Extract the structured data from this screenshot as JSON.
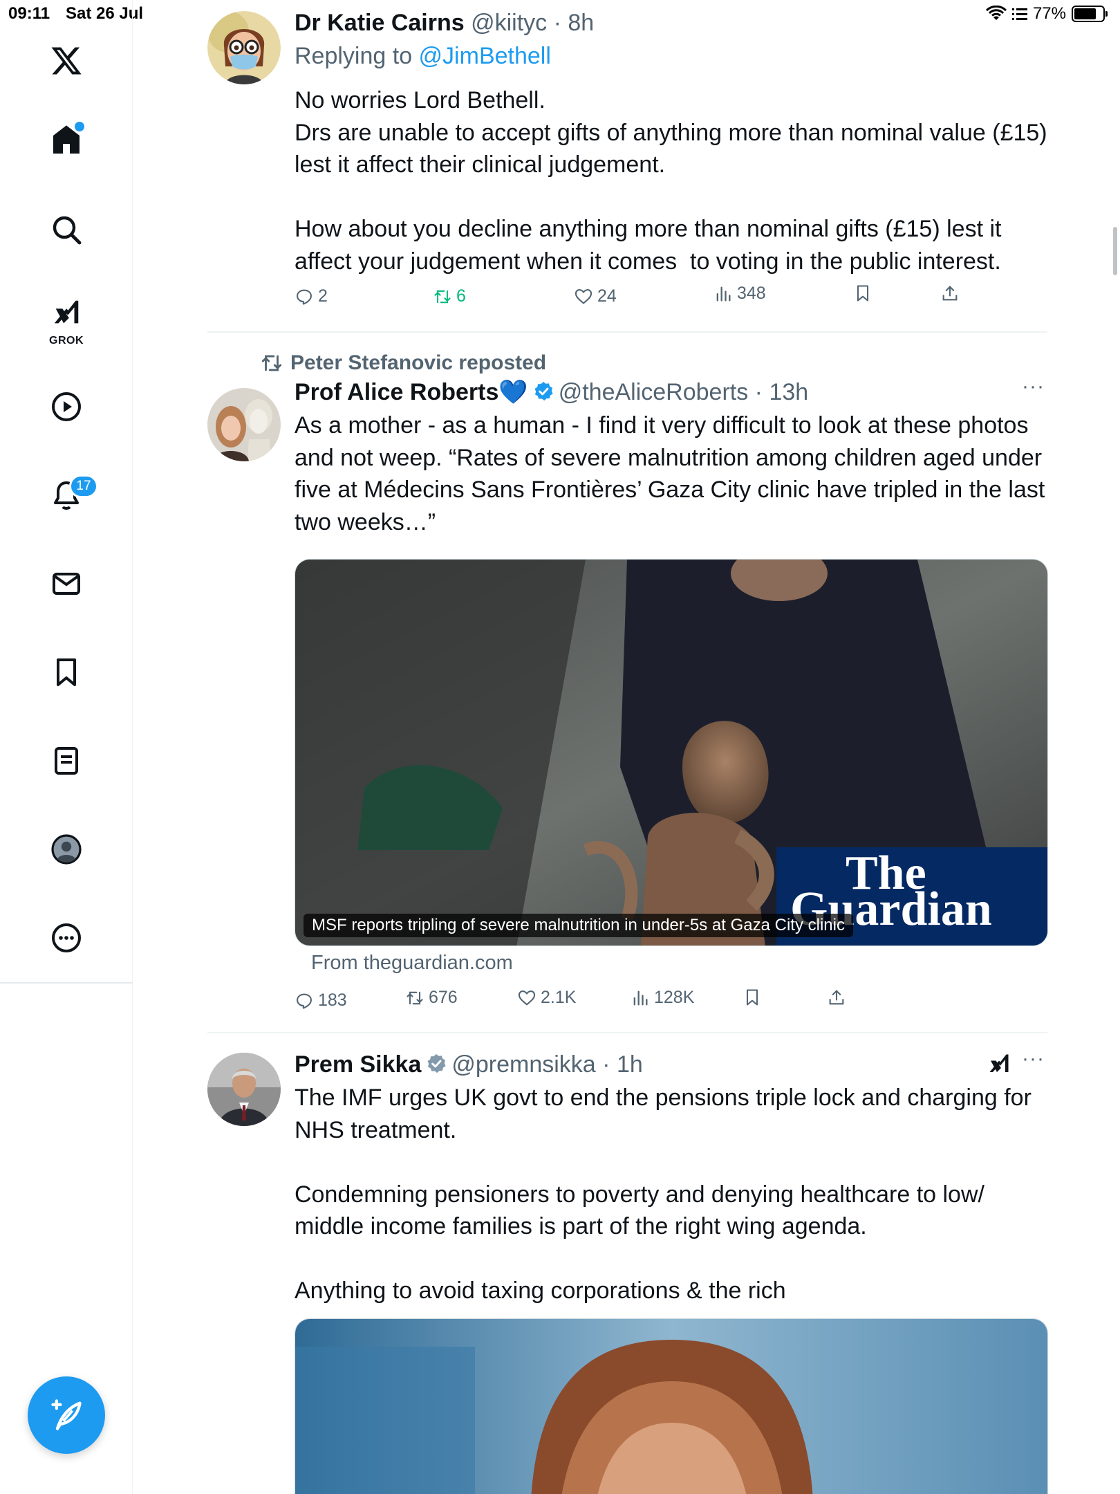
{
  "status_bar": {
    "time": "09:11",
    "date": "Sat 26 Jul",
    "battery": "77%",
    "battery_level": 0.77
  },
  "sidebar": {
    "items": [
      {
        "name": "home",
        "icon": "home-icon"
      },
      {
        "name": "search",
        "icon": "search-icon"
      },
      {
        "name": "grok",
        "icon": "grok-icon",
        "label": "GROK"
      },
      {
        "name": "videos",
        "icon": "play-icon"
      },
      {
        "name": "notifications",
        "icon": "bell-icon",
        "badge": "17"
      },
      {
        "name": "messages",
        "icon": "mail-icon"
      },
      {
        "name": "bookmarks",
        "icon": "bookmark-icon"
      },
      {
        "name": "lists",
        "icon": "list-icon"
      },
      {
        "name": "profile",
        "icon": "profile-icon"
      },
      {
        "name": "more",
        "icon": "more-icon"
      }
    ]
  },
  "tweets": [
    {
      "name": "Dr Katie Cairns",
      "handle": "@kiityc",
      "time": "8h",
      "replying_prefix": "Replying to ",
      "replying_to": "@JimBethell",
      "text": "No worries Lord Bethell.\nDrs are unable to accept gifts of anything more than nominal value (£15) lest it affect their clinical judgement.\n\nHow about you decline anything more than nominal gifts (£15) lest it affect your judgement when it comes  to voting in the public interest.",
      "replies": "2",
      "retweets": "6",
      "likes": "24",
      "views": "348"
    },
    {
      "reposted_by": "Peter Stefanovic reposted",
      "name": "Prof Alice Roberts💙",
      "handle": "@theAliceRoberts",
      "time": "13h",
      "text": "As a mother - as a human - I find it very difficult to look at these photos and not weep. “Rates of severe malnutrition among children aged under five at Médecins Sans Frontières’ Gaza City clinic have tripled in the last two weeks…”",
      "card_caption": "MSF reports tripling of severe malnutrition in under-5s at Gaza City clinic",
      "card_brand_line1": "The",
      "card_brand_line2": "Guardian",
      "card_source": "From theguardian.com",
      "replies": "183",
      "retweets": "676",
      "likes": "2.1K",
      "views": "128K"
    },
    {
      "name": "Prem Sikka",
      "handle": "@premnsikka",
      "time": "1h",
      "text": "The IMF urges UK govt to end the pensions triple lock and charging for NHS treatment.\n\nCondemning pensioners to poverty and denying healthcare to low/ middle income families is part of the right wing agenda.\n\nAnything to avoid taxing corporations & the rich"
    }
  ],
  "colors": {
    "accent": "#1d9bf0",
    "retweet": "#00ba7c",
    "muted": "#536471",
    "guardian": "#052962"
  }
}
